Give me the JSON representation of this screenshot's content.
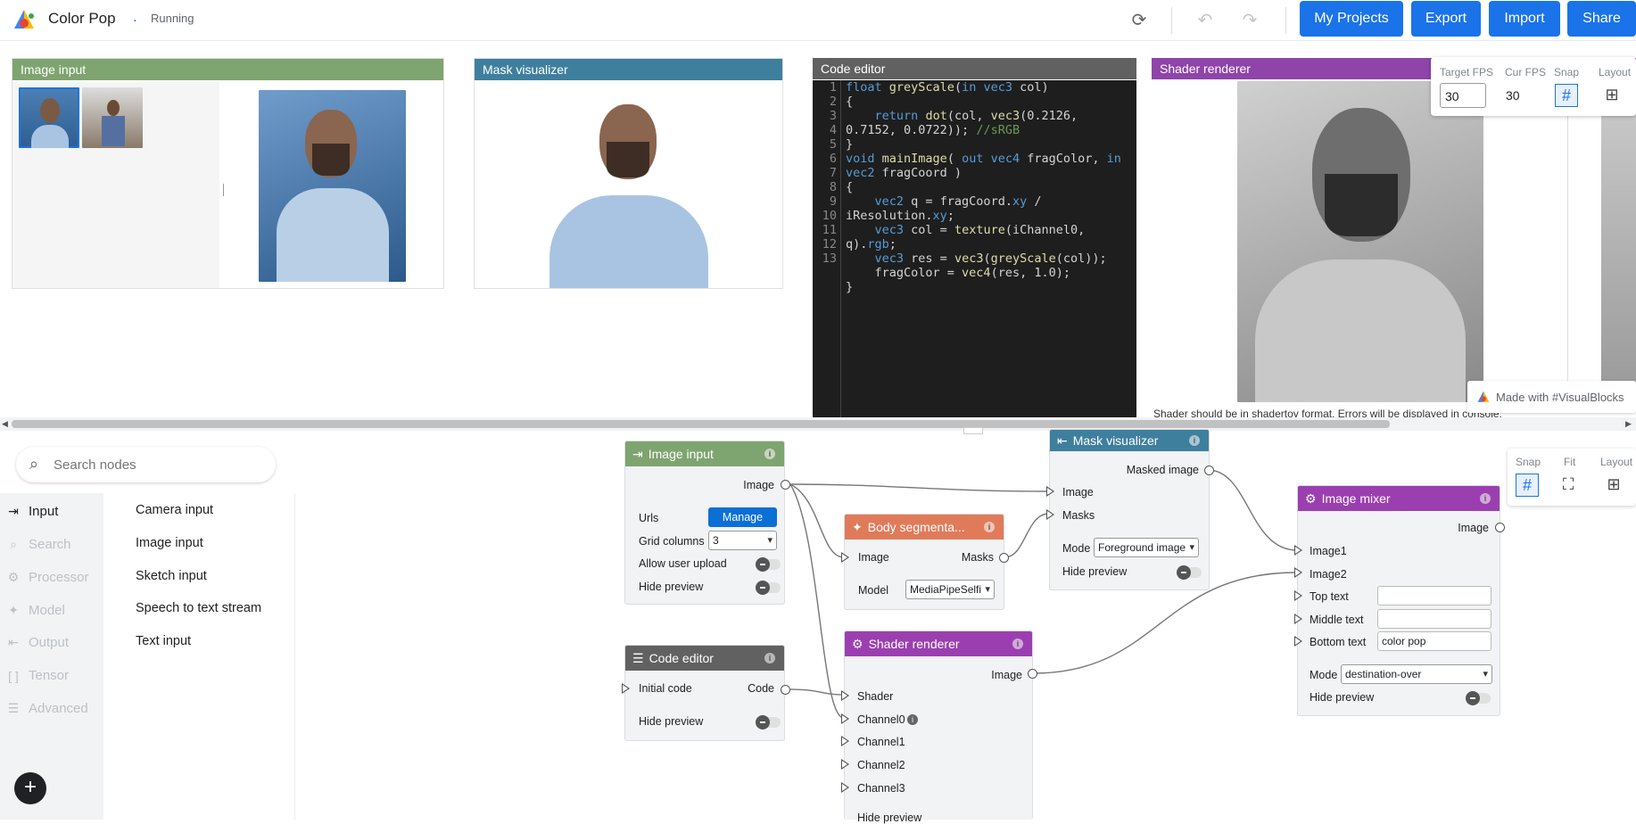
{
  "header": {
    "app_title": "Color Pop",
    "separator": ".",
    "status": "Running",
    "buttons": {
      "my_projects": "My Projects",
      "export": "Export",
      "import": "Import",
      "share": "Share"
    }
  },
  "panels": {
    "image_input": {
      "title": "Image input",
      "color": "#7ea46f"
    },
    "mask_visualizer": {
      "title": "Mask visualizer",
      "color": "#3f7f9e"
    },
    "code_editor": {
      "title": "Code editor",
      "color": "#616161"
    },
    "shader_renderer": {
      "title": "Shader renderer",
      "color": "#8e44a8",
      "message": "Shader should be in shadertoy format. Errors will be displayed in console."
    }
  },
  "code_lines": [
    "1",
    "2",
    "3",
    "",
    "4",
    "5",
    "6",
    "",
    "7",
    "8",
    "",
    "9",
    "",
    "10",
    "11",
    "12",
    "13"
  ],
  "fps": {
    "target_label": "Target FPS",
    "target_value": "30",
    "cur_label": "Cur FPS",
    "cur_value": "30",
    "snap_label": "Snap",
    "layout_label": "Layout"
  },
  "made_with": "Made with #VisualBlocks",
  "sidebar": {
    "search_placeholder": "Search nodes",
    "categories": [
      "Input",
      "Search",
      "Processor",
      "Model",
      "Output",
      "Tensor",
      "Advanced"
    ],
    "items": [
      "Camera input",
      "Image input",
      "Sketch input",
      "Speech to text stream",
      "Text input"
    ]
  },
  "canvas_controls": {
    "snap": "Snap",
    "fit": "Fit",
    "layout": "Layout"
  },
  "nodes": {
    "image_input": {
      "title": "Image input",
      "out_image": "Image",
      "urls": "Urls",
      "manage": "Manage",
      "grid_columns": "Grid columns",
      "grid_value": "3",
      "allow_upload": "Allow user upload",
      "hide_preview": "Hide preview",
      "color": "#7ea46f"
    },
    "code_editor": {
      "title": "Code editor",
      "in_initial": "Initial code",
      "out_code": "Code",
      "hide_preview": "Hide preview",
      "color": "#616161"
    },
    "body_seg": {
      "title": "Body segmenta...",
      "in_image": "Image",
      "out_masks": "Masks",
      "model": "Model",
      "model_value": "MediaPipeSelfi",
      "color": "#e07b5a"
    },
    "mask_vis": {
      "title": "Mask visualizer",
      "out": "Masked image",
      "in_image": "Image",
      "in_masks": "Masks",
      "mode": "Mode",
      "mode_value": "Foreground image",
      "hide_preview": "Hide preview",
      "color": "#3f7f9e"
    },
    "shader": {
      "title": "Shader renderer",
      "out_image": "Image",
      "in_shader": "Shader",
      "in_ch0": "Channel0",
      "in_ch1": "Channel1",
      "in_ch2": "Channel2",
      "in_ch3": "Channel3",
      "hide_preview": "Hide preview",
      "color": "#9b3fb0"
    },
    "mixer": {
      "title": "Image mixer",
      "out_image": "Image",
      "in_image1": "Image1",
      "in_image2": "Image2",
      "top_text": "Top text",
      "middle_text": "Middle text",
      "bottom_text": "Bottom text",
      "bottom_value": "color pop",
      "mode": "Mode",
      "mode_value": "destination-over",
      "hide_preview": "Hide preview",
      "color": "#9b3fb0"
    }
  }
}
